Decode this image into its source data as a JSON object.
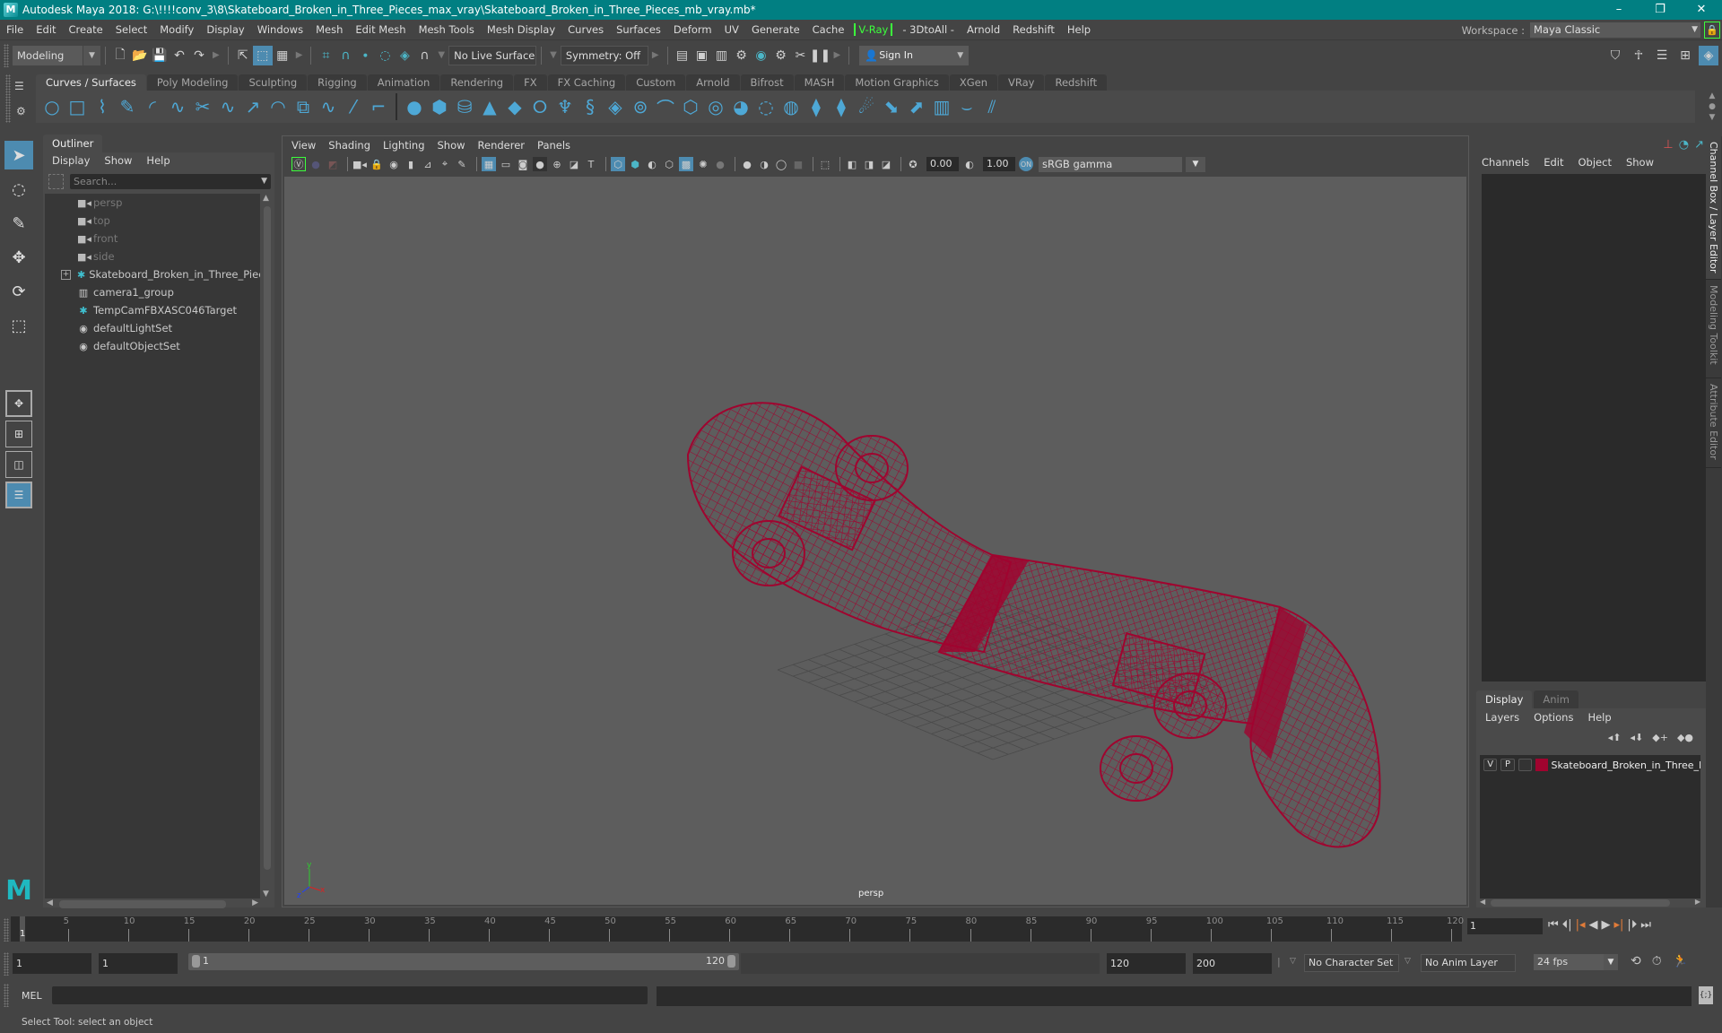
{
  "window": {
    "title": "Autodesk Maya 2018: G:\\!!!!conv_3\\8\\Skateboard_Broken_in_Three_Pieces_max_vray\\Skateboard_Broken_in_Three_Pieces_mb_vray.mb*",
    "controls": {
      "minimize": "–",
      "maximize": "❐",
      "close": "✕"
    }
  },
  "menubar": {
    "items": [
      "File",
      "Edit",
      "Create",
      "Select",
      "Modify",
      "Display",
      "Windows",
      "Mesh",
      "Edit Mesh",
      "Mesh Tools",
      "Mesh Display",
      "Curves",
      "Surfaces",
      "Deform",
      "UV",
      "Generate",
      "Cache"
    ],
    "vray": "V-Ray",
    "items_after": [
      "- 3DtoAll -",
      "Arnold",
      "Redshift",
      "Help"
    ],
    "workspace_label": "Workspace :",
    "workspace_value": "Maya Classic"
  },
  "statusline": {
    "mode": "Modeling",
    "live_surface": "No Live Surface",
    "symmetry": "Symmetry: Off",
    "sign_in": "Sign In"
  },
  "shelf": {
    "tabs": [
      "Curves / Surfaces",
      "Poly Modeling",
      "Sculpting",
      "Rigging",
      "Animation",
      "Rendering",
      "FX",
      "FX Caching",
      "Custom",
      "Arnold",
      "Bifrost",
      "MASH",
      "Motion Graphics",
      "XGen",
      "VRay",
      "Redshift"
    ],
    "active_tab": "Curves / Surfaces"
  },
  "outliner": {
    "tab": "Outliner",
    "menu": [
      "Display",
      "Show",
      "Help"
    ],
    "search_placeholder": "Search...",
    "items": [
      {
        "name": "persp",
        "icon": "camera-icon",
        "dim": true
      },
      {
        "name": "top",
        "icon": "camera-icon",
        "dim": true
      },
      {
        "name": "front",
        "icon": "camera-icon",
        "dim": true
      },
      {
        "name": "side",
        "icon": "camera-icon",
        "dim": true
      },
      {
        "name": "Skateboard_Broken_in_Three_Pieces_",
        "icon": "locator-icon",
        "expandable": true
      },
      {
        "name": "camera1_group",
        "icon": "group-icon"
      },
      {
        "name": "TempCamFBXASC046Target",
        "icon": "locator-icon"
      },
      {
        "name": "defaultLightSet",
        "icon": "set-icon"
      },
      {
        "name": "defaultObjectSet",
        "icon": "set-icon"
      }
    ]
  },
  "viewport": {
    "menu": [
      "View",
      "Shading",
      "Lighting",
      "Show",
      "Renderer",
      "Panels"
    ],
    "exposure": "0.00",
    "gamma": "1.00",
    "color_space": "sRGB gamma",
    "camera_label": "persp",
    "axis": {
      "x": "x",
      "y": "y",
      "z": "z"
    },
    "wire_color": "#a0042f"
  },
  "channelbox": {
    "menu": [
      "Channels",
      "Edit",
      "Object",
      "Show"
    ]
  },
  "sidetabs": [
    "Channel Box / Layer Editor",
    "Modeling Toolkit",
    "Attribute Editor"
  ],
  "layereditor": {
    "tabs": [
      "Display",
      "Anim"
    ],
    "menu": [
      "Layers",
      "Options",
      "Help"
    ],
    "layer": {
      "v": "V",
      "p": "P",
      "name": "Skateboard_Broken_in_Three_Pieces",
      "color": "#a0042f"
    }
  },
  "timeline": {
    "ticks": [
      5,
      10,
      15,
      20,
      25,
      30,
      35,
      40,
      45,
      50,
      55,
      60,
      65,
      70,
      75,
      80,
      85,
      90,
      95,
      100,
      105,
      110,
      115,
      120
    ],
    "current": "1",
    "current_frame_field": "1"
  },
  "range": {
    "start": "1",
    "playback_start": "1",
    "range_start_label": "1",
    "range_end_label": "120",
    "playback_end": "120",
    "end": "200",
    "character_set": "No Character Set",
    "anim_layer": "No Anim Layer",
    "fps": "24 fps"
  },
  "commandline": {
    "label": "MEL"
  },
  "helpline": {
    "text": "Select Tool: select an object"
  }
}
